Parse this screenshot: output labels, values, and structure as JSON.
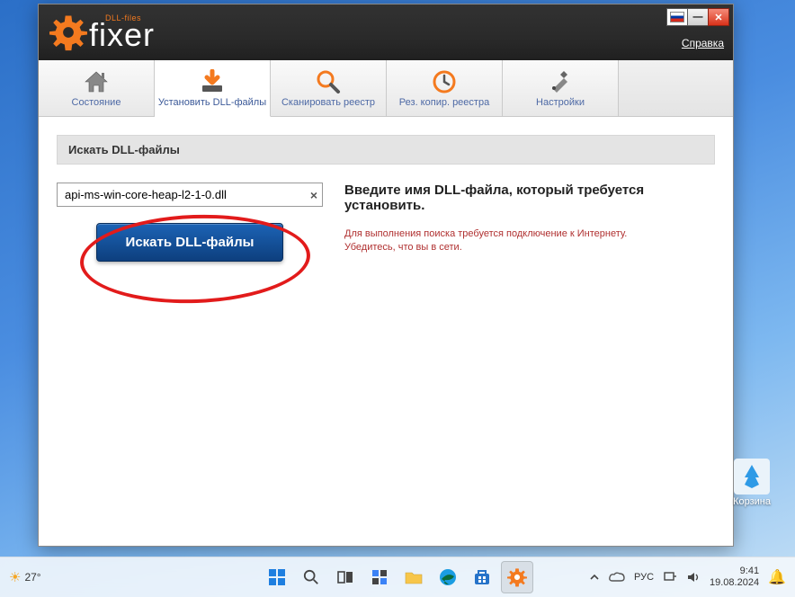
{
  "header": {
    "logo_small": "DLL-files",
    "logo_big": "fixer",
    "help": "Справка"
  },
  "tabs": [
    {
      "label": "Состояние"
    },
    {
      "label": "Установить DLL-файлы"
    },
    {
      "label": "Сканировать реестр"
    },
    {
      "label": "Рез. копир. реестра"
    },
    {
      "label": "Настройки"
    }
  ],
  "section": {
    "title": "Искать DLL-файлы"
  },
  "search": {
    "value": "api-ms-win-core-heap-l2-1-0.dll",
    "button": "Искать DLL-файлы"
  },
  "instructions": {
    "heading": "Введите имя DLL-файла, который требуется установить.",
    "line1": "Для выполнения поиска требуется подключение к Интернету.",
    "line2": "Убедитесь, что вы в сети."
  },
  "desktop": {
    "recycle": "Корзина"
  },
  "taskbar": {
    "weather_temp": "27°",
    "lang": "РУС",
    "time": "9:41",
    "date": "19.08.2024"
  }
}
